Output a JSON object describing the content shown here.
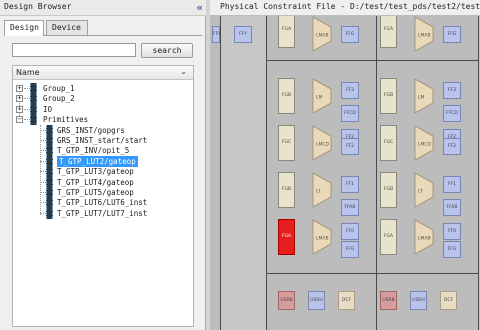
{
  "design_browser": {
    "title": "Design Browser",
    "collapse_glyph": "«",
    "tabs": [
      {
        "label": "Design",
        "active": true
      },
      {
        "label": "Device",
        "active": false
      }
    ],
    "search": {
      "value": "",
      "button_label": "search"
    },
    "tree": {
      "header": "Name",
      "header_chevron": "⌄",
      "items": [
        {
          "label": "Group_1",
          "expander": "+",
          "level": 0
        },
        {
          "label": "Group_2",
          "expander": "+",
          "level": 0
        },
        {
          "label": "IO",
          "expander": "+",
          "level": 0
        },
        {
          "label": "Primitives",
          "expander": "−",
          "level": 0
        },
        {
          "label": "GRS_INST/gopgrs",
          "level": 1
        },
        {
          "label": "GRS_INST_start/start",
          "level": 1
        },
        {
          "label": "T_GTP_INV/opit_5",
          "level": 1
        },
        {
          "label": "T_GTP_LUT2/gateop",
          "level": 1,
          "selected": true
        },
        {
          "label": "T_GTP_LUT3/gateop",
          "level": 1
        },
        {
          "label": "T_GTP_LUT4/gateop",
          "level": 1
        },
        {
          "label": "T_GTP_LUT5/gateop",
          "level": 1
        },
        {
          "label": "T_GTP_LUT6/LUT6_inst",
          "level": 1
        },
        {
          "label": "T_GTP_LUT7/LUT7_inst",
          "level": 1
        }
      ]
    }
  },
  "physical_constraint": {
    "title": "Physical Constraint File - D:/test/test_pds/test2/test.pcf",
    "labels": {
      "fgb": "FGB",
      "fgc": "FGC",
      "fga": "FGA",
      "ffy": "FFY",
      "lm": "LM",
      "lmab": "LMAB",
      "lmcd": "LMCD",
      "lt": "LT",
      "ff0": "FF0",
      "ff1": "FF1",
      "ff2": "FF2",
      "ff3": "FF3",
      "ffcd": "FFCD",
      "ffab": "FFAB",
      "ffg": "FFG",
      "usrb": "USRB",
      "usrh": "USRH",
      "dcf": "DCF"
    },
    "colors": {
      "selected_cell": "#e81d1d",
      "fg_block": "#e7e3cd",
      "ff_block": "#b8c4ec",
      "lut_block": "#e9d9b8"
    }
  }
}
